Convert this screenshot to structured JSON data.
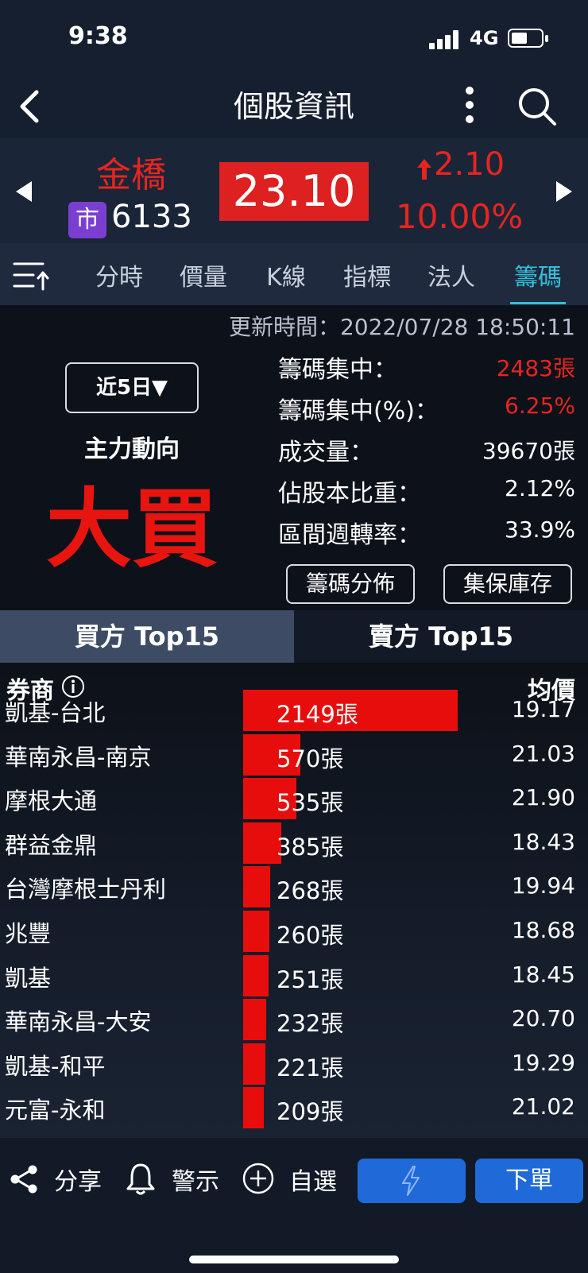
{
  "status": {
    "time": "9:38",
    "network": "4G"
  },
  "nav": {
    "title": "個股資訊"
  },
  "quote": {
    "name": "金橋",
    "market_badge": "市",
    "code": "6133",
    "price": "23.10",
    "change": "2.10",
    "change_percent": "10.00%"
  },
  "tabs": [
    {
      "label": "分時",
      "active": false
    },
    {
      "label": "價量",
      "active": false
    },
    {
      "label": "K線",
      "active": false
    },
    {
      "label": "指標",
      "active": false
    },
    {
      "label": "法人",
      "active": false
    },
    {
      "label": "籌碼",
      "active": true
    }
  ],
  "chip": {
    "update_time": "更新時間：2022/07/28 18:50:11",
    "period": "近5日▼",
    "force_label": "主力動向",
    "force_value": "大買",
    "stats": [
      {
        "label": "籌碼集中：",
        "value": "2483張",
        "highlight": true
      },
      {
        "label": "籌碼集中(%)：",
        "value": "6.25%",
        "highlight": true
      },
      {
        "label": "成交量：",
        "value": "39670張",
        "highlight": false
      },
      {
        "label": "佔股本比重：",
        "value": "2.12%",
        "highlight": false
      },
      {
        "label": "區間週轉率：",
        "value": "33.9%",
        "highlight": false
      }
    ],
    "buttons": [
      "籌碼分佈",
      "集保庫存"
    ]
  },
  "side_tabs": {
    "buy": "買方 Top15",
    "sell": "賣方 Top15"
  },
  "list": {
    "header_broker": "券商",
    "header_price": "均價",
    "max_volume": 2149,
    "rows": [
      {
        "broker": "凱基-台北",
        "volume": 2149,
        "volume_label": "2149張",
        "avg_price": "19.17"
      },
      {
        "broker": "華南永昌-南京",
        "volume": 570,
        "volume_label": "570張",
        "avg_price": "21.03"
      },
      {
        "broker": "摩根大通",
        "volume": 535,
        "volume_label": "535張",
        "avg_price": "21.90"
      },
      {
        "broker": "群益金鼎",
        "volume": 385,
        "volume_label": "385張",
        "avg_price": "18.43"
      },
      {
        "broker": "台灣摩根士丹利",
        "volume": 268,
        "volume_label": "268張",
        "avg_price": "19.94"
      },
      {
        "broker": "兆豐",
        "volume": 260,
        "volume_label": "260張",
        "avg_price": "18.68"
      },
      {
        "broker": "凱基",
        "volume": 251,
        "volume_label": "251張",
        "avg_price": "18.45"
      },
      {
        "broker": "華南永昌-大安",
        "volume": 232,
        "volume_label": "232張",
        "avg_price": "20.70"
      },
      {
        "broker": "凱基-和平",
        "volume": 221,
        "volume_label": "221張",
        "avg_price": "19.29"
      },
      {
        "broker": "元富-永和",
        "volume": 209,
        "volume_label": "209張",
        "avg_price": "21.02"
      }
    ]
  },
  "bottom": {
    "share": "分享",
    "alert": "警示",
    "watchlist": "自選",
    "order": "下單"
  },
  "colors": {
    "up_red": "#e52520",
    "bar_red": "#e80d0d",
    "accent_cyan": "#33c0d8",
    "button_blue": "#1f6ad8",
    "market_badge_purple": "#7a3fd0"
  }
}
